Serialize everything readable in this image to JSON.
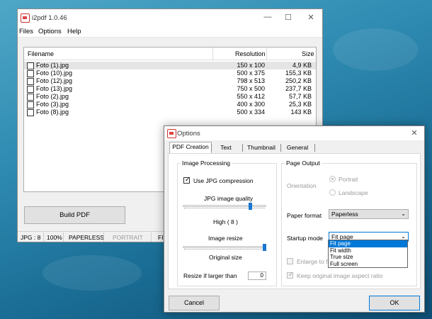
{
  "main_window": {
    "title": "i2pdf 1.0.46",
    "menu": [
      "Files",
      "Options",
      "Help"
    ],
    "list_headers": {
      "filename": "Filename",
      "resolution": "Resolution",
      "size": "Size"
    },
    "files": [
      {
        "name": "Foto (1).jpg",
        "resolution": "150 x 100",
        "size": "4,9 KB"
      },
      {
        "name": "Foto (10).jpg",
        "resolution": "500 x 375",
        "size": "155,3 KB"
      },
      {
        "name": "Foto (12).jpg",
        "resolution": "798 x 513",
        "size": "250,2 KB"
      },
      {
        "name": "Foto (13).jpg",
        "resolution": "750 x 500",
        "size": "237,7 KB"
      },
      {
        "name": "Foto (2).jpg",
        "resolution": "550 x 412",
        "size": "57,7 KB"
      },
      {
        "name": "Foto (3).jpg",
        "resolution": "400 x 300",
        "size": "25,3 KB"
      },
      {
        "name": "Foto (8).jpg",
        "resolution": "500 x 334",
        "size": "143 KB"
      }
    ],
    "build_button": "Build PDF",
    "status": [
      "JPG : 8",
      "100%",
      "PAPERLESS",
      "PORTRAIT",
      "FIT"
    ]
  },
  "options_dialog": {
    "title": "Options",
    "tabs": [
      "PDF Creation",
      "Text",
      "Thumbnail",
      "General"
    ],
    "image_processing": {
      "title": "Image Processing",
      "use_jpg_compression": "Use JPG compression",
      "jpg_quality_label": "JPG image quality",
      "jpg_quality_value": "High ( 8 )",
      "jpg_quality_level": 0.82,
      "image_resize_label": "Image resize",
      "image_resize_value": "Original size",
      "image_resize_level": 1.0,
      "resize_if_larger": "Resize if larger than",
      "resize_value": "0"
    },
    "page_output": {
      "title": "Page Output",
      "orientation_label": "Orientation",
      "portrait": "Portrait",
      "landscape": "Landscape",
      "paper_format_label": "Paper format",
      "paper_format_value": "Paperless",
      "startup_mode_label": "Startup mode",
      "startup_mode_value": "Fit page",
      "startup_options": [
        "Fit page",
        "Fit width",
        "True size",
        "Full screen"
      ],
      "enlarge_to_fit": "Enlarge to fit",
      "keep_aspect": "Keep original image aspect ratio"
    },
    "cancel_button": "Cancel",
    "ok_button": "OK"
  },
  "colors": {
    "accent": "#0078d7",
    "slider": "#1976d2",
    "desktop": "#2f8bb2"
  }
}
